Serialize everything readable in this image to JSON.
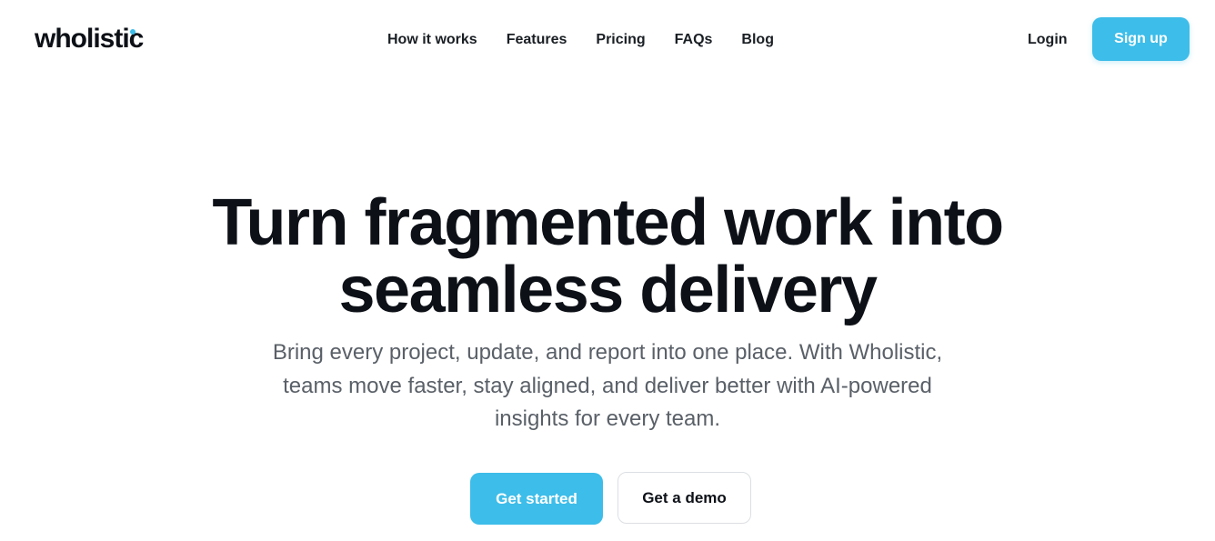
{
  "brand": {
    "logo_text": "wholistic",
    "accent_color": "#3dbde9"
  },
  "nav": {
    "items": [
      {
        "label": "How it works"
      },
      {
        "label": "Features"
      },
      {
        "label": "Pricing"
      },
      {
        "label": "FAQs"
      },
      {
        "label": "Blog"
      }
    ]
  },
  "auth": {
    "login_label": "Login",
    "signup_label": "Sign up"
  },
  "hero": {
    "title_line1": "Turn fragmented work into",
    "title_line2": "seamless delivery",
    "subtitle": "Bring every project, update, and report into one place. With Wholistic, teams move faster, stay aligned, and deliver better with AI-powered insights for every team.",
    "primary_cta": "Get started",
    "secondary_cta": "Get a demo"
  }
}
